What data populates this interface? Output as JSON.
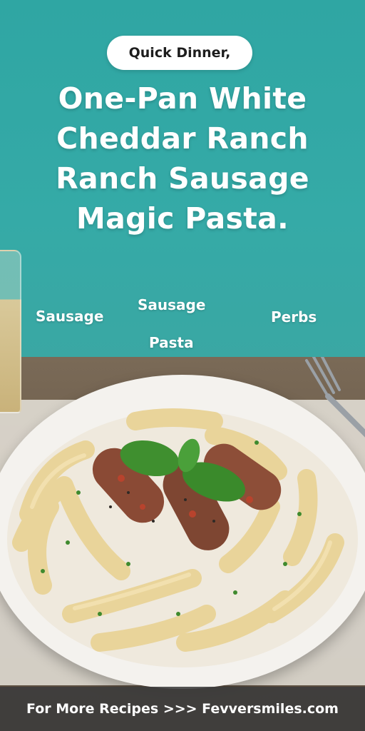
{
  "header": {
    "tagline": "Quick Dinner,",
    "title_lines": [
      "One-Pan White",
      "Cheddar Ranch",
      "Ranch Sausage",
      "Magic Pasta."
    ]
  },
  "labels": {
    "sausage_left": "Sausage",
    "sausage_top": "Sausage",
    "perbs": "Perbs",
    "pasta": "Pasta"
  },
  "footer": {
    "text": "For More Recipes >>> Fevversmiles.com"
  },
  "colors": {
    "background_teal": "#35aaa7",
    "pill_bg": "#ffffff",
    "footer_bg": "#3c3c3c"
  }
}
